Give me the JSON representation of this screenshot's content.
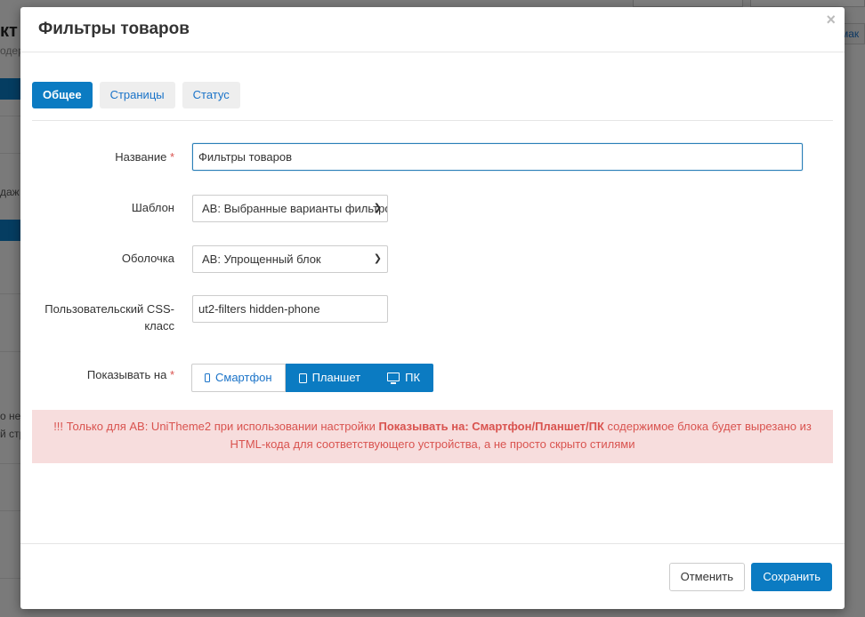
{
  "background": {
    "title_fragment": "кт",
    "subtitle_fragment": "одер",
    "right_link_fragment": "мак",
    "snippet1": "даж",
    "snippet2": "о не",
    "snippet3": "й стр"
  },
  "modal": {
    "title": "Фильтры товаров",
    "close_glyph": "×"
  },
  "tabs": [
    {
      "label": "Общее",
      "active": true
    },
    {
      "label": "Страницы",
      "active": false
    },
    {
      "label": "Статус",
      "active": false
    }
  ],
  "form": {
    "name": {
      "label": "Название",
      "required_mark": "*",
      "value": "Фильтры товаров"
    },
    "template": {
      "label": "Шаблон",
      "selected": "AB: Выбранные варианты фильтров"
    },
    "wrapper": {
      "label": "Оболочка",
      "selected": "AB: Упрощенный блок"
    },
    "css_class": {
      "label_line1": "Пользовательский CSS-",
      "label_line2": "класс",
      "value": "ut2-filters hidden-phone"
    },
    "show_on": {
      "label": "Показывать на",
      "required_mark": "*",
      "options": [
        {
          "label": "Смартфон",
          "icon": "smartphone-icon",
          "active": false
        },
        {
          "label": "Планшет",
          "icon": "tablet-icon",
          "active": true
        },
        {
          "label": "ПК",
          "icon": "desktop-icon",
          "active": true
        }
      ]
    }
  },
  "alert": {
    "prefix": "!!! Только для AB: UniTheme2 при использовании настройки ",
    "bold": "Показывать на: Смартфон/Планшет/ПК",
    "suffix": " содержимое блока будет вырезано из HTML-кода для соответствующего устройства, а не просто скрыто стилями"
  },
  "footer": {
    "cancel_label": "Отменить",
    "save_label": "Сохранить"
  },
  "colors": {
    "primary": "#0b7bc2",
    "link": "#1a73c8",
    "danger_text": "#d9534f",
    "danger_bg": "#f7dddd"
  }
}
